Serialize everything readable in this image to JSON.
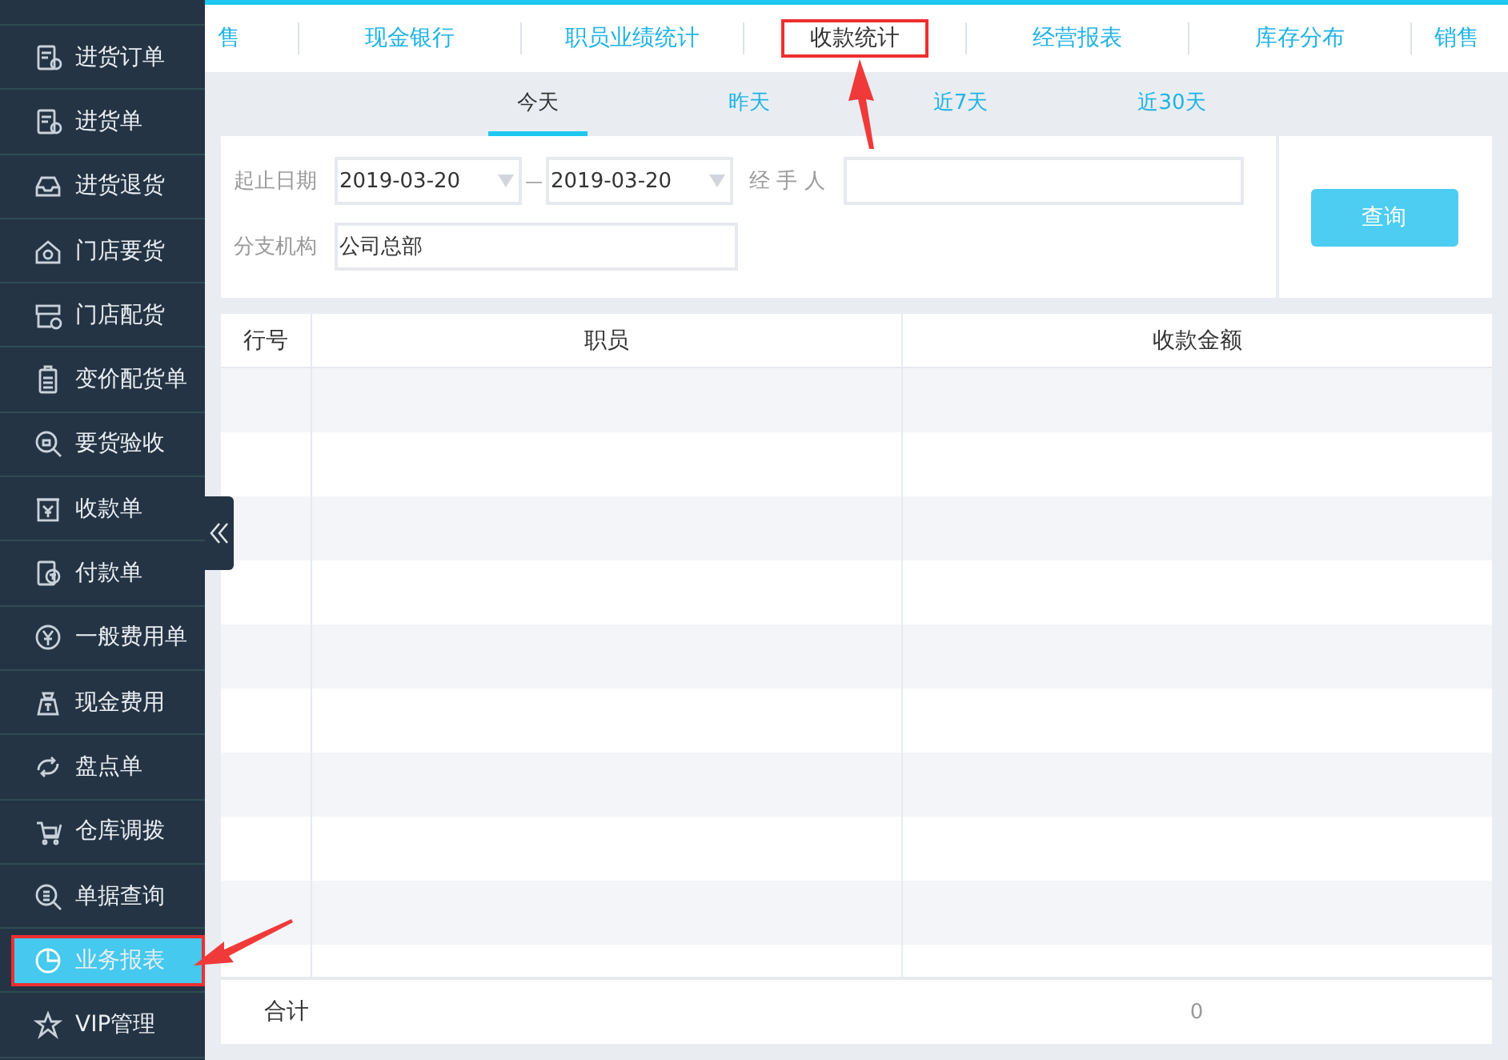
{
  "sidebar": {
    "items": [
      {
        "label": "进货订单",
        "selected": false,
        "highlighted": false
      },
      {
        "label": "进货单",
        "selected": false,
        "highlighted": false
      },
      {
        "label": "进货退货",
        "selected": false,
        "highlighted": false
      },
      {
        "label": "门店要货",
        "selected": false,
        "highlighted": false
      },
      {
        "label": "门店配货",
        "selected": false,
        "highlighted": false
      },
      {
        "label": "变价配货单",
        "selected": false,
        "highlighted": false
      },
      {
        "label": "要货验收",
        "selected": false,
        "highlighted": false
      },
      {
        "label": "收款单",
        "selected": false,
        "highlighted": false
      },
      {
        "label": "付款单",
        "selected": false,
        "highlighted": false
      },
      {
        "label": "一般费用单",
        "selected": false,
        "highlighted": false
      },
      {
        "label": "现金费用",
        "selected": false,
        "highlighted": false
      },
      {
        "label": "盘点单",
        "selected": false,
        "highlighted": false
      },
      {
        "label": "仓库调拨",
        "selected": false,
        "highlighted": false
      },
      {
        "label": "单据查询",
        "selected": false,
        "highlighted": false
      },
      {
        "label": "业务报表",
        "selected": true,
        "highlighted": true
      },
      {
        "label": "VIP管理",
        "selected": false,
        "highlighted": false
      }
    ]
  },
  "report_tabs": [
    {
      "label": "售",
      "selected": false,
      "highlighted": false
    },
    {
      "label": "现金银行",
      "selected": false,
      "highlighted": false
    },
    {
      "label": "职员业绩统计",
      "selected": false,
      "highlighted": false
    },
    {
      "label": "收款统计",
      "selected": true,
      "highlighted": true
    },
    {
      "label": "经营报表",
      "selected": false,
      "highlighted": false
    },
    {
      "label": "库存分布",
      "selected": false,
      "highlighted": false
    },
    {
      "label": "销售",
      "selected": false,
      "highlighted": false
    }
  ],
  "period_tabs": [
    {
      "label": "今天",
      "selected": true
    },
    {
      "label": "昨天",
      "selected": false
    },
    {
      "label": "近7天",
      "selected": false
    },
    {
      "label": "近30天",
      "selected": false
    }
  ],
  "filters": {
    "date_label": "起止日期",
    "date_from": "2019-03-20",
    "date_separator": "—",
    "date_to": "2019-03-20",
    "handler_label": "经 手 人",
    "branch_label": "分支机构",
    "branch_value": "公司总部"
  },
  "query_button": "查询",
  "table": {
    "columns": [
      "行号",
      "职员",
      "收款金额"
    ]
  },
  "footer": {
    "label": "合计",
    "total": "0"
  }
}
